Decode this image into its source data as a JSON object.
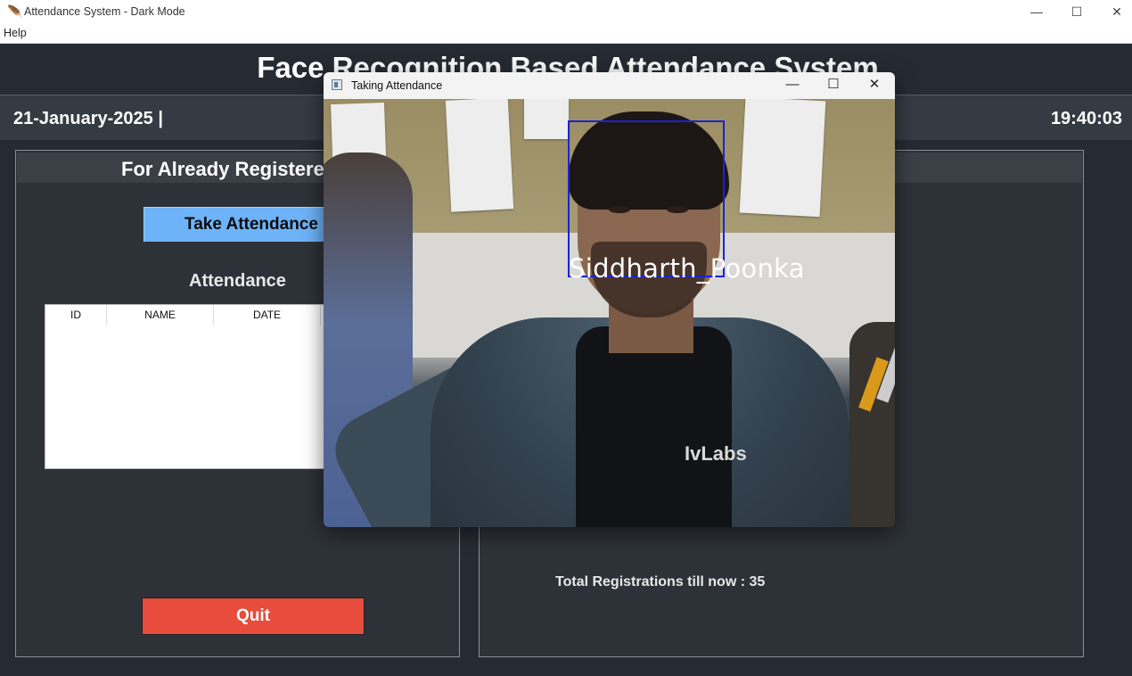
{
  "window": {
    "title": "Attendance System - Dark Mode",
    "minimize_glyph": "—",
    "maximize_glyph": "☐",
    "close_glyph": "✕"
  },
  "menu": {
    "help": "Help"
  },
  "header": {
    "title": "Face Recognition Based Attendance System",
    "date": "21-January-2025  |",
    "time": "19:40:03"
  },
  "left_panel": {
    "heading": "For Already Registered",
    "take_attendance_label": "Take Attendance",
    "attendance_label": "Attendance",
    "table_columns": [
      "ID",
      "NAME",
      "DATE"
    ],
    "quit_label": "Quit"
  },
  "right_panel": {
    "total_registrations": "Total Registrations till now  : 35"
  },
  "popup": {
    "title": "Taking Attendance",
    "minimize_glyph": "—",
    "maximize_glyph": "☐",
    "close_glyph": "✕",
    "recognized_name": "Siddharth_Poonka",
    "shirt_logo": "IvLabs"
  },
  "colors": {
    "background": "#262b33",
    "take_button": "#6eb3f7",
    "quit_button": "#e74c3c",
    "face_box": "#1a23d6"
  }
}
